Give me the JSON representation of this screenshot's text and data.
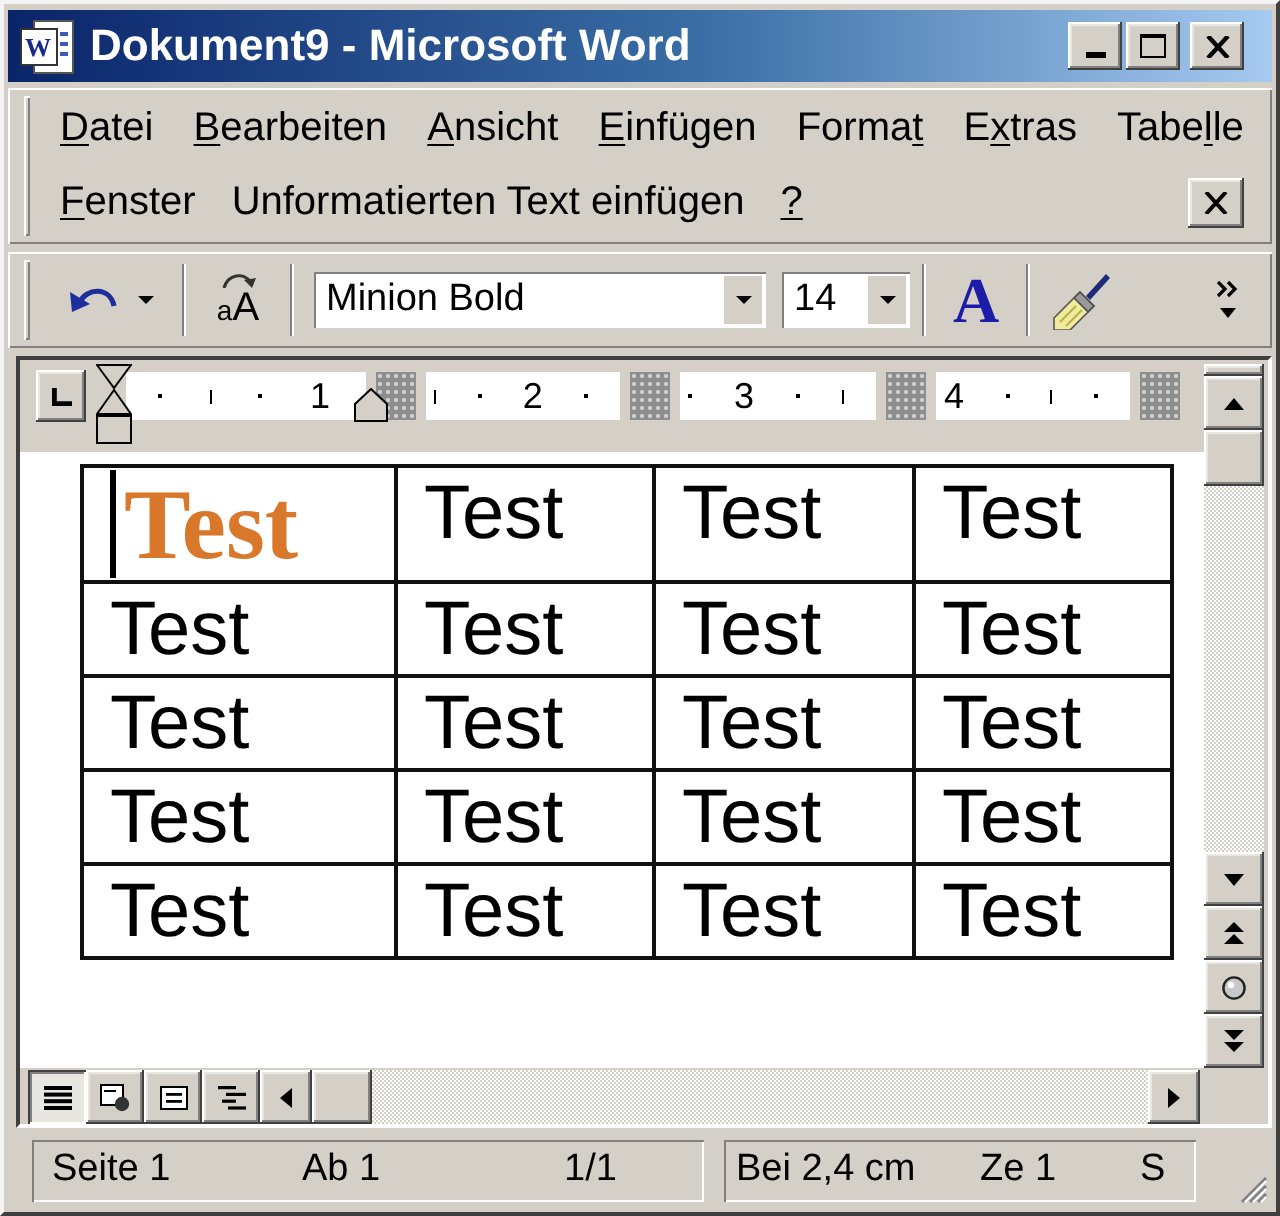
{
  "title_bar": {
    "icon_letter": "W",
    "title": "Dokument9 - Microsoft Word"
  },
  "menu_bar": {
    "lines": [
      {
        "items": [
          {
            "runs": [
              {
                "text": "D",
                "underlined": true
              },
              {
                "text": "atei",
                "underlined": false
              }
            ]
          },
          {
            "runs": [
              {
                "text": "B",
                "underlined": true
              },
              {
                "text": "earbeiten",
                "underlined": false
              }
            ]
          },
          {
            "runs": [
              {
                "text": "A",
                "underlined": true
              },
              {
                "text": "nsicht",
                "underlined": false
              }
            ]
          },
          {
            "runs": [
              {
                "text": "E",
                "underlined": true
              },
              {
                "text": "infügen",
                "underlined": false
              }
            ]
          },
          {
            "runs": [
              {
                "text": "Forma",
                "underlined": false
              },
              {
                "text": "t",
                "underlined": true
              }
            ]
          },
          {
            "runs": [
              {
                "text": "E",
                "underlined": false
              },
              {
                "text": "x",
                "underlined": true
              },
              {
                "text": "tras",
                "underlined": false
              }
            ]
          },
          {
            "runs": [
              {
                "text": "Tabe",
                "underlined": false
              },
              {
                "text": "l",
                "underlined": true
              },
              {
                "text": "le",
                "underlined": false
              }
            ]
          }
        ]
      },
      {
        "items": [
          {
            "runs": [
              {
                "text": "F",
                "underlined": true
              },
              {
                "text": "enster",
                "underlined": false
              }
            ]
          },
          {
            "runs": [
              {
                "text": "Unformatierten Text einfügen",
                "underlined": false
              }
            ]
          },
          {
            "runs": [
              {
                "text": "?",
                "underlined": true
              }
            ]
          }
        ]
      }
    ]
  },
  "toolbar": {
    "change_case_letters": [
      "a",
      "A"
    ],
    "font": "Minion Bold",
    "size": "14",
    "font_color_letter": "A"
  },
  "ruler": {
    "numbers": [
      "1",
      "2",
      "3",
      "4"
    ]
  },
  "document": {
    "table": {
      "rows": [
        {
          "cells": [
            {
              "text": "Test",
              "kind": "formatted",
              "caret": true
            },
            {
              "text": "Test",
              "kind": "plain",
              "caret": false
            },
            {
              "text": "Test",
              "kind": "plain",
              "caret": false
            },
            {
              "text": "Test",
              "kind": "plain",
              "caret": false
            }
          ]
        },
        {
          "cells": [
            {
              "text": "Test",
              "kind": "plain",
              "caret": false
            },
            {
              "text": "Test",
              "kind": "plain",
              "caret": false
            },
            {
              "text": "Test",
              "kind": "plain",
              "caret": false
            },
            {
              "text": "Test",
              "kind": "plain",
              "caret": false
            }
          ]
        },
        {
          "cells": [
            {
              "text": "Test",
              "kind": "plain",
              "caret": false
            },
            {
              "text": "Test",
              "kind": "plain",
              "caret": false
            },
            {
              "text": "Test",
              "kind": "plain",
              "caret": false
            },
            {
              "text": "Test",
              "kind": "plain",
              "caret": false
            }
          ]
        },
        {
          "cells": [
            {
              "text": "Test",
              "kind": "plain",
              "caret": false
            },
            {
              "text": "Test",
              "kind": "plain",
              "caret": false
            },
            {
              "text": "Test",
              "kind": "plain",
              "caret": false
            },
            {
              "text": "Test",
              "kind": "plain",
              "caret": false
            }
          ]
        },
        {
          "cells": [
            {
              "text": "Test",
              "kind": "plain",
              "caret": false
            },
            {
              "text": "Test",
              "kind": "plain",
              "caret": false
            },
            {
              "text": "Test",
              "kind": "plain",
              "caret": false
            },
            {
              "text": "Test",
              "kind": "plain",
              "caret": false
            }
          ]
        }
      ]
    }
  },
  "view_buttons": [
    {
      "kind": "normal",
      "selected": true
    },
    {
      "kind": "web",
      "selected": false
    },
    {
      "kind": "print",
      "selected": false
    },
    {
      "kind": "outline",
      "selected": false
    }
  ],
  "status_bar": {
    "panels": [
      {
        "items": [
          "Seite 1",
          "Ab 1",
          "1/1"
        ]
      },
      {
        "items": [
          "Bei 2,4 cm",
          "Ze 1",
          "S"
        ]
      }
    ]
  }
}
